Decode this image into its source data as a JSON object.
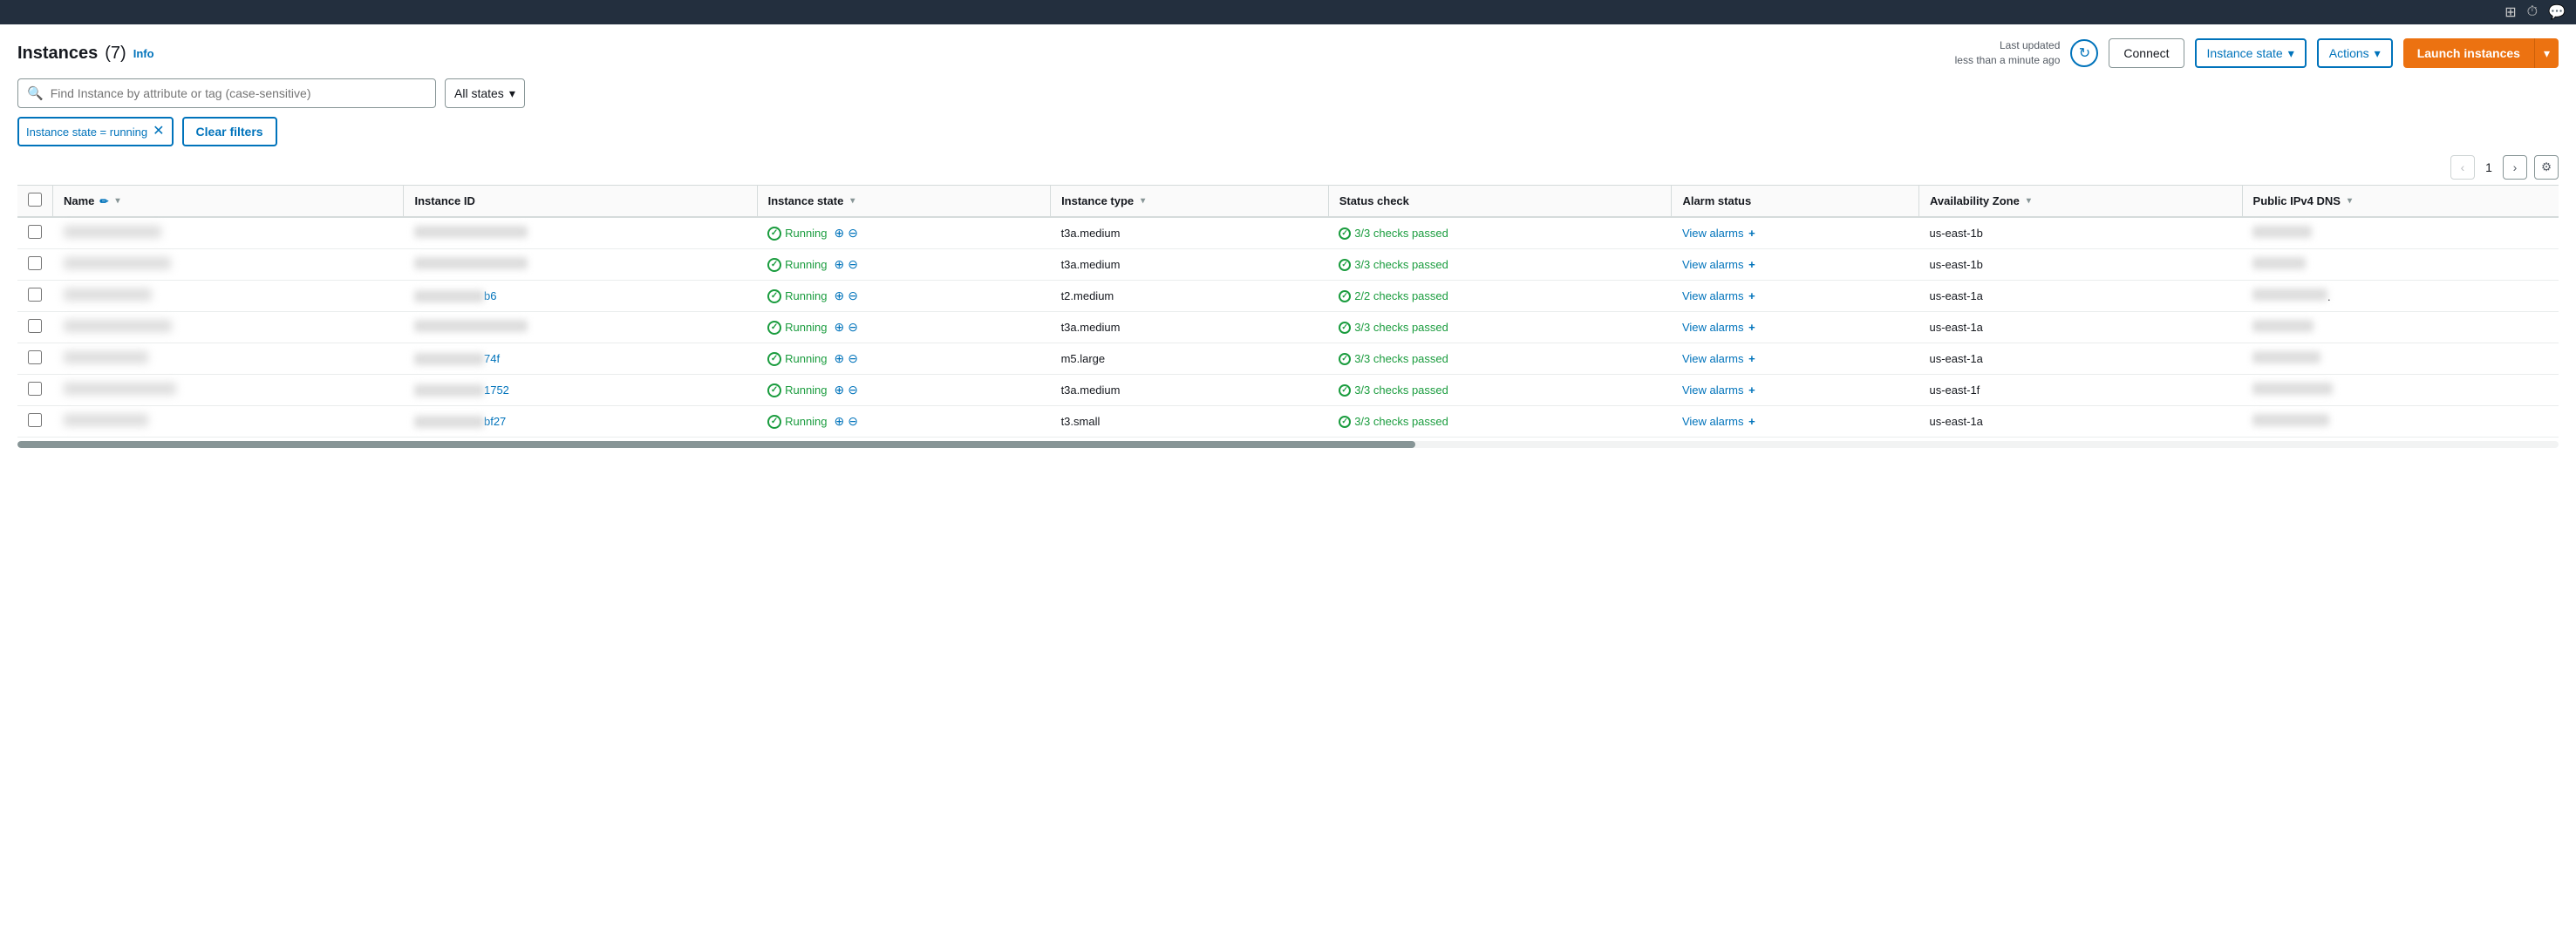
{
  "topBar": {
    "icons": [
      "monitor-icon",
      "clock-icon",
      "message-icon"
    ]
  },
  "header": {
    "title": "Instances",
    "count": "(7)",
    "infoLabel": "Info",
    "lastUpdated": "Last updated",
    "lastUpdatedTime": "less than a minute ago",
    "connectLabel": "Connect",
    "instanceStateLabel": "Instance state",
    "actionsLabel": "Actions",
    "launchLabel": "Launch instances"
  },
  "search": {
    "placeholder": "Find Instance by attribute or tag (case-sensitive)"
  },
  "stateFilter": {
    "label": "All states"
  },
  "activeFilter": {
    "text": "Instance state = running",
    "clearLabel": "Clear filters"
  },
  "pagination": {
    "currentPage": "1"
  },
  "table": {
    "columns": [
      "Name",
      "Instance ID",
      "Instance state",
      "Instance type",
      "Status check",
      "Alarm status",
      "Availability Zone",
      "Public IPv4 DNS"
    ],
    "rows": [
      {
        "name": "",
        "instanceId": "",
        "instanceIdPartial": "",
        "state": "Running",
        "instanceType": "t3a.medium",
        "statusCheck": "3/3 checks passed",
        "alarmStatus": "View alarms",
        "availabilityZone": "us-east-1b",
        "publicDns": ""
      },
      {
        "name": "",
        "instanceId": "",
        "instanceIdPartial": "",
        "state": "Running",
        "instanceType": "t3a.medium",
        "statusCheck": "3/3 checks passed",
        "alarmStatus": "View alarms",
        "availabilityZone": "us-east-1b",
        "publicDns": ""
      },
      {
        "name": "",
        "instanceId": "c7...b6",
        "instanceIdPartial": "b6",
        "state": "Running",
        "instanceType": "t2.medium",
        "statusCheck": "2/2 checks passed",
        "alarmStatus": "View alarms",
        "availabilityZone": "us-east-1a",
        "publicDns": "."
      },
      {
        "name": "",
        "instanceId": "",
        "instanceIdPartial": "",
        "state": "Running",
        "instanceType": "t3a.medium",
        "statusCheck": "3/3 checks passed",
        "alarmStatus": "View alarms",
        "availabilityZone": "us-east-1a",
        "publicDns": ""
      },
      {
        "name": "",
        "instanceId": "i-...74f",
        "instanceIdPartial": "74f",
        "state": "Running",
        "instanceType": "m5.large",
        "statusCheck": "3/3 checks passed",
        "alarmStatus": "View alarms",
        "availabilityZone": "us-east-1a",
        "publicDns": ""
      },
      {
        "name": "",
        "instanceId": "i-...1752",
        "instanceIdPartial": "1752",
        "state": "Running",
        "instanceType": "t3a.medium",
        "statusCheck": "3/3 checks passed",
        "alarmStatus": "View alarms",
        "availabilityZone": "us-east-1f",
        "publicDns": ""
      },
      {
        "name": "",
        "instanceId": "i-...bf27",
        "instanceIdPartial": "bf27",
        "state": "Running",
        "instanceType": "t3.small",
        "statusCheck": "3/3 checks passed",
        "alarmStatus": "View alarms",
        "availabilityZone": "us-east-1a",
        "publicDns": ""
      }
    ]
  },
  "colors": {
    "orange": "#ec7211",
    "blue": "#0073bb",
    "green": "#1a9c3e",
    "border": "#d5dbdb"
  }
}
